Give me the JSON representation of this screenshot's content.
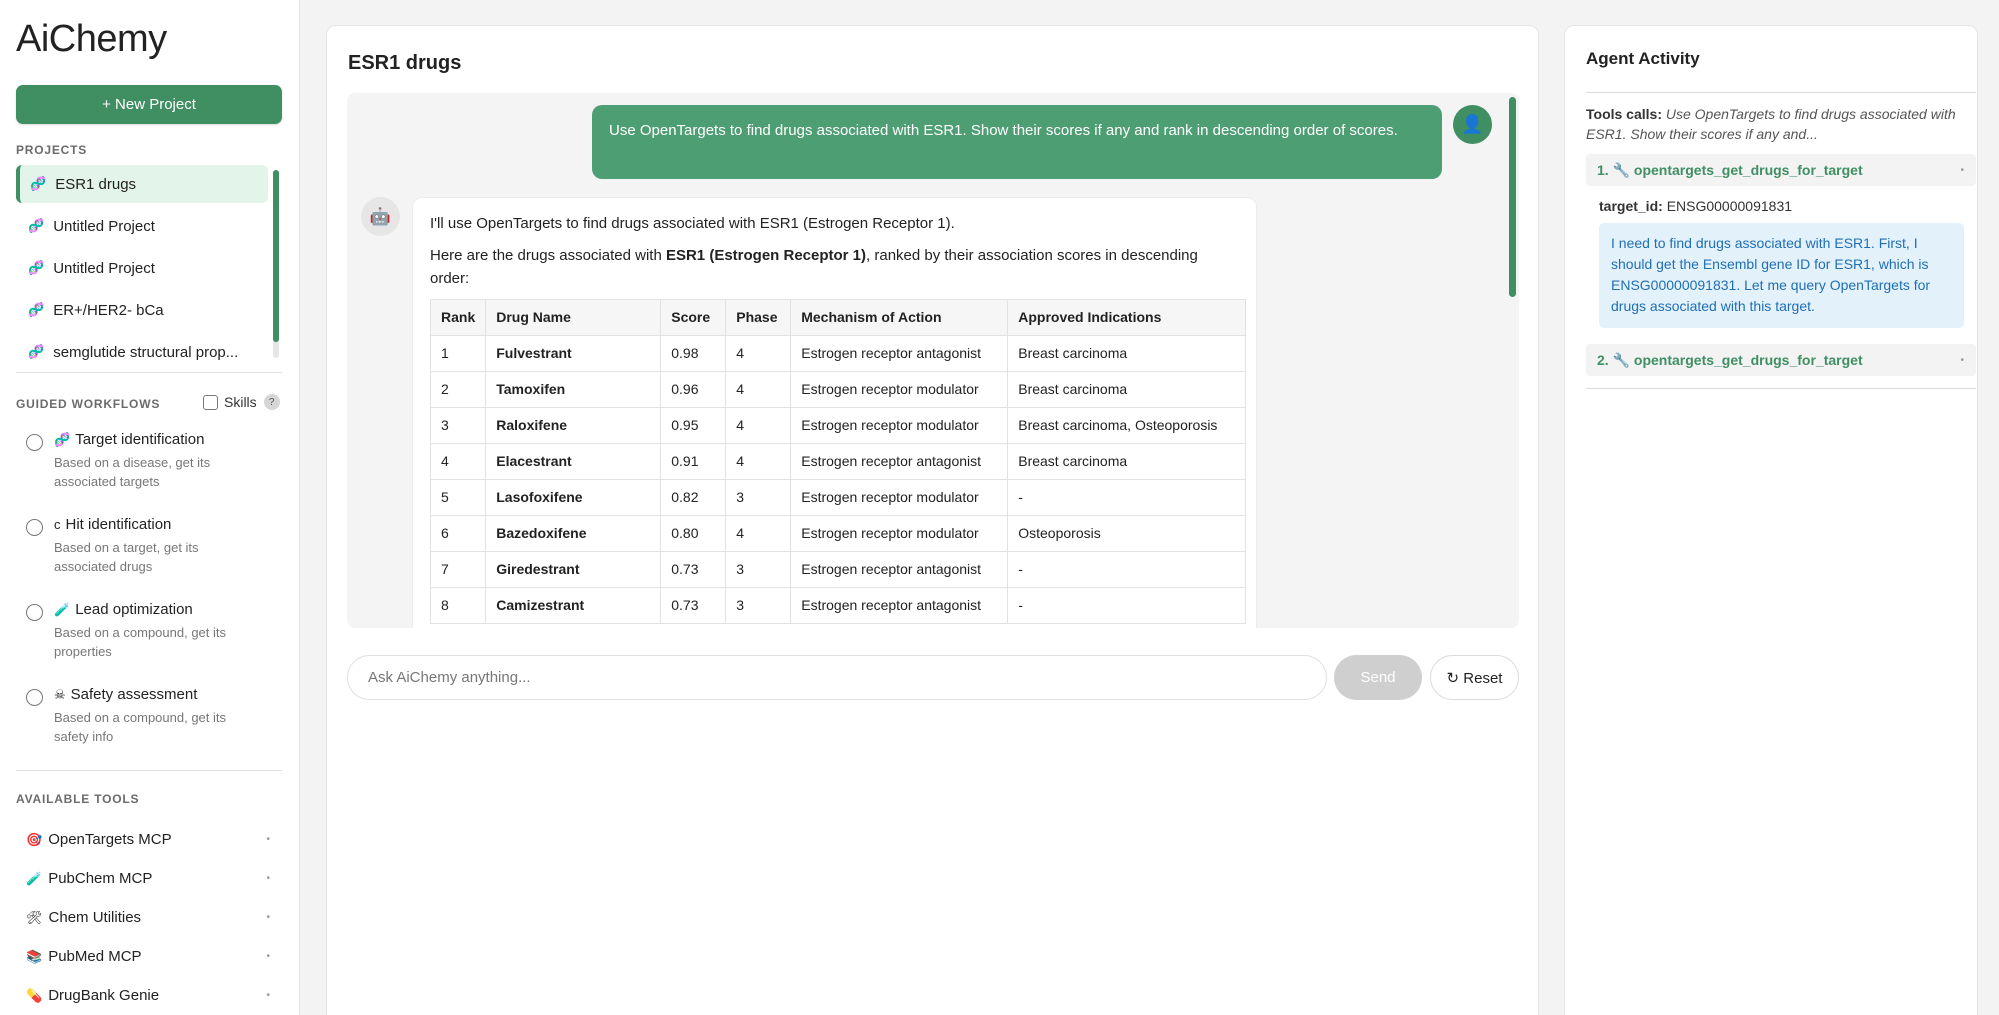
{
  "sidebar": {
    "logo": "AiChemy",
    "new_project_label": "+ New Project",
    "projects_label": "PROJECTS",
    "projects": [
      {
        "label": "ESR1 drugs",
        "icon": "dna-icon",
        "active": true
      },
      {
        "label": "Untitled Project",
        "icon": "dna-icon"
      },
      {
        "label": "Untitled Project",
        "icon": "dna-icon"
      },
      {
        "label": "ER+/HER2- bCa",
        "icon": "dna-icon"
      },
      {
        "label": "semglutide structural prop...",
        "icon": "dna-icon"
      }
    ],
    "workflows_label": "GUIDED WORKFLOWS",
    "skills_label": "Skills",
    "skills_help": "?",
    "workflows": [
      {
        "title": "Target identification",
        "icon": "🧬",
        "desc": "Based on a disease, get its associated targets"
      },
      {
        "title": "Hit identification",
        "icon": "c",
        "desc": "Based on a target, get its associated drugs"
      },
      {
        "title": "Lead optimization",
        "icon": "🧪",
        "desc": "Based on a compound, get its properties"
      },
      {
        "title": "Safety assessment",
        "icon": "☠",
        "desc": "Based on a compound, get its safety info"
      }
    ],
    "tools_label": "AVAILABLE TOOLS",
    "tools": [
      {
        "label": "OpenTargets MCP",
        "icon": "🎯"
      },
      {
        "label": "PubChem MCP",
        "icon": "🧪"
      },
      {
        "label": "Chem Utilities",
        "icon": "🛠"
      },
      {
        "label": "PubMed MCP",
        "icon": "📚"
      },
      {
        "label": "DrugBank Genie",
        "icon": "💊"
      }
    ]
  },
  "main": {
    "title": "ESR1 drugs",
    "user_message": "Use OpenTargets to find drugs associated with ESR1. Show their scores if any and rank in descending order of scores.",
    "bot_intro": "I'll use OpenTargets to find drugs associated with ESR1 (Estrogen Receptor 1).",
    "bot_text_pre": "Here are the drugs associated with ",
    "bot_text_bold": "ESR1 (Estrogen Receptor 1)",
    "bot_text_post": ", ranked by their association scores in descending order:",
    "table": {
      "headers": [
        "Rank",
        "Drug Name",
        "Score",
        "Phase",
        "Mechanism of Action",
        "Approved Indications"
      ],
      "rows": [
        [
          "1",
          "Fulvestrant",
          "0.98",
          "4",
          "Estrogen receptor antagonist",
          "Breast carcinoma"
        ],
        [
          "2",
          "Tamoxifen",
          "0.96",
          "4",
          "Estrogen receptor modulator",
          "Breast carcinoma"
        ],
        [
          "3",
          "Raloxifene",
          "0.95",
          "4",
          "Estrogen receptor modulator",
          "Breast carcinoma, Osteoporosis"
        ],
        [
          "4",
          "Elacestrant",
          "0.91",
          "4",
          "Estrogen receptor antagonist",
          "Breast carcinoma"
        ],
        [
          "5",
          "Lasofoxifene",
          "0.82",
          "3",
          "Estrogen receptor modulator",
          "-"
        ],
        [
          "6",
          "Bazedoxifene",
          "0.80",
          "4",
          "Estrogen receptor modulator",
          "Osteoporosis"
        ],
        [
          "7",
          "Giredestrant",
          "0.73",
          "3",
          "Estrogen receptor antagonist",
          "-"
        ],
        [
          "8",
          "Camizestrant",
          "0.73",
          "3",
          "Estrogen receptor antagonist",
          "-"
        ]
      ]
    },
    "input_placeholder": "Ask AiChemy anything...",
    "send_label": "Send",
    "reset_label": "↻ Reset"
  },
  "agent": {
    "title": "Agent Activity",
    "tool_calls_label": "Tools calls:",
    "tool_calls_text": "Use OpenTargets to find drugs associated with ESR1. Show their scores if any and...",
    "calls": [
      {
        "label": "1. 🔧 opentargets_get_drugs_for_target"
      },
      {
        "label": "2. 🔧 opentargets_get_drugs_for_target"
      }
    ],
    "param_label": "target_id:",
    "param_value": "ENSG00000091831",
    "thought": "I need to find drugs associated with ESR1. First, I should get the Ensembl gene ID for ESR1, which is ENSG00000091831. Let me query OpenTargets for drugs associated with this target."
  },
  "colors": {
    "accent": "#3f8f63",
    "user_bubble": "#4e9e74",
    "thought_bg": "#e3f1fb",
    "thought_text": "#1f6fb5"
  }
}
